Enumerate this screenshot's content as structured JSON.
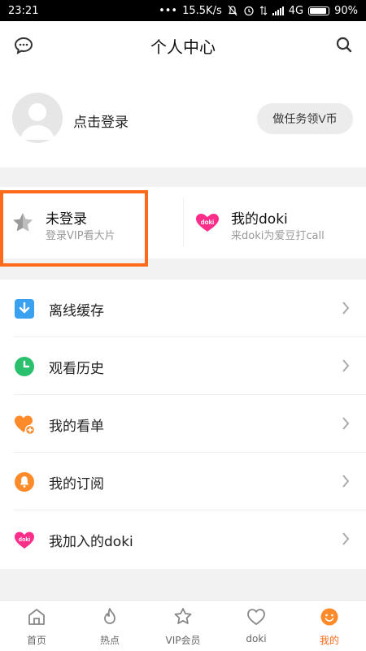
{
  "status_bar": {
    "time": "23:21",
    "dots": "•••",
    "speed": "15.5K/s",
    "network": "4G",
    "battery": "90%",
    "battery_level": 0.9
  },
  "header": {
    "title": "个人中心",
    "left_icon": "message-icon",
    "right_icon": "search-icon"
  },
  "profile": {
    "login_prompt": "点击登录",
    "task_button": "做任务领V币"
  },
  "vip_card": {
    "title": "未登录",
    "subtitle": "登录VIP看大片",
    "icon": "star-icon"
  },
  "doki_card": {
    "title": "我的doki",
    "subtitle": "来doki为爱豆打call",
    "icon": "doki-icon",
    "badge": "doki"
  },
  "menu": [
    {
      "label": "离线缓存",
      "icon": "download-icon",
      "color": "#3aa0f0"
    },
    {
      "label": "观看历史",
      "icon": "clock-icon",
      "color": "#2bc06d"
    },
    {
      "label": "我的看单",
      "icon": "heart-plus-icon",
      "color": "#ff8a2a"
    },
    {
      "label": "我的订阅",
      "icon": "subscribe-icon",
      "color": "#ff8a2a"
    },
    {
      "label": "我加入的doki",
      "icon": "doki-icon",
      "color": "#ff2d8a"
    }
  ],
  "tabs": [
    {
      "label": "首页",
      "icon": "home-icon"
    },
    {
      "label": "热点",
      "icon": "flame-icon"
    },
    {
      "label": "VIP会员",
      "icon": "vip-star-icon"
    },
    {
      "label": "doki",
      "icon": "doki-heart-icon"
    },
    {
      "label": "我的",
      "icon": "smile-icon",
      "active": true
    }
  ],
  "colors": {
    "accent": "#ff6a1a",
    "highlight_border": "#ff6a1a"
  }
}
